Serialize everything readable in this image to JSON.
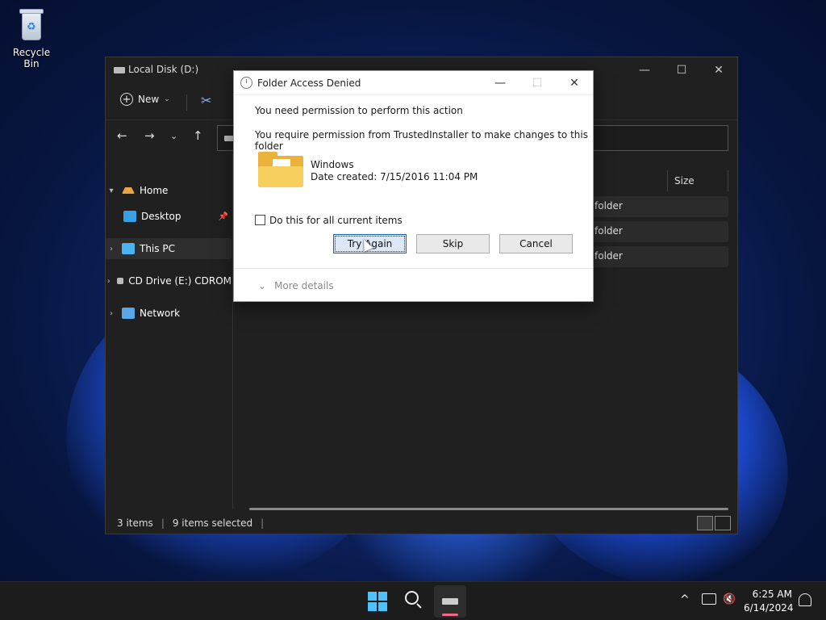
{
  "desktop": {
    "recycle_bin_label": "Recycle Bin"
  },
  "explorer": {
    "title": "Local Disk (D:)",
    "toolbar": {
      "new_label": "New"
    },
    "sidebar": {
      "items": [
        {
          "label": "Home"
        },
        {
          "label": "Desktop"
        },
        {
          "label": "This PC"
        },
        {
          "label": "CD Drive (E:) CDROM"
        },
        {
          "label": "Network"
        }
      ]
    },
    "columns": {
      "size": "Size"
    },
    "rows": [
      {
        "type": "folder"
      },
      {
        "type": "folder"
      },
      {
        "type": "folder"
      }
    ],
    "status": {
      "items": "3 items",
      "selected": "9 items selected"
    }
  },
  "dialog": {
    "title": "Folder Access Denied",
    "line1": "You need permission to perform this action",
    "line2": "You require permission from TrustedInstaller to make changes to this folder",
    "folder_name": "Windows",
    "date_created": "Date created: 7/15/2016 11:04 PM",
    "checkbox_label": "Do this for all current items",
    "try_again": "Try Again",
    "skip": "Skip",
    "cancel": "Cancel",
    "more_details": "More details"
  },
  "taskbar": {
    "time": "6:25 AM",
    "date": "6/14/2024"
  },
  "colors": {
    "accent": "#4cc2ff",
    "folder": "#f7cf5e",
    "explorer_bg": "#202020"
  }
}
